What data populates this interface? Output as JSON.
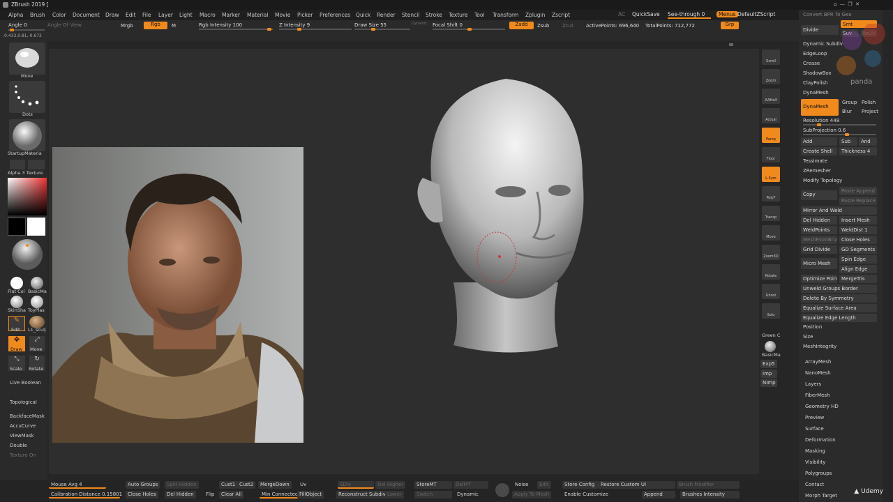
{
  "app": {
    "title": "ZBrush 2019 ["
  },
  "menus": [
    "Alpha",
    "Brush",
    "Color",
    "Document",
    "Draw",
    "Edit",
    "File",
    "Layer",
    "Light",
    "Macro",
    "Marker",
    "Material",
    "Movie",
    "Picker",
    "Preferences",
    "Quick",
    "Render",
    "Stencil",
    "Stroke",
    "Texture",
    "Tool",
    "Transform",
    "Zplugin",
    "Zscript"
  ],
  "menubar_right": {
    "ac": "AC",
    "quicksave": "QuickSave",
    "seethrough": "See-through  0",
    "menus": "Menus",
    "script": "DefaultZScript"
  },
  "ctrl": {
    "angle": "Angle 0",
    "angle_of_view": "Angle Of View",
    "mrgb": "Mrgb",
    "rgb": "Rgb",
    "m": "M",
    "rgb_intensity": "Rgb Intensity 100",
    "zadd": "Zadd",
    "zsub": "Zsub",
    "zcut": "Zcut",
    "z_intensity": "Z Intensity 9",
    "draw_size": "Draw Size 55",
    "dynamic": "Dynamic",
    "focal_shift": "Focal Shift 0",
    "active_points": "ActivePoints: 696,640",
    "total_points": "TotalPoints: 712,772",
    "grp": "Grp",
    "coords": "-0.433,0.81,-0.672"
  },
  "left": {
    "move": "Move",
    "dots": "Dots",
    "startup_material": "StartupMateria",
    "alpha_texture": "Alpha 3 Texture",
    "flat_col": "Flat Col",
    "basic_m": "BasicMa",
    "skin_shade": "SkinSha",
    "toy_plas": "ToyPlas",
    "edit": "Edit",
    "l1_scul": "L1_sculj",
    "draw": "Draw",
    "move2": "Move",
    "scale": "Scale",
    "rotate": "Rotate",
    "live_boolean": "Live Boolean",
    "topological": "Topological",
    "backface": "BackfaceMask",
    "accucurve": "AccuCurve",
    "viewmask": "ViewMask",
    "double": "Double",
    "texture_on": "Texture On"
  },
  "rtool": [
    "Scroll",
    "Zoom",
    "AAHalf",
    "Actual",
    "Persp",
    "Floor",
    "L.Sym",
    "PolyF",
    "Transp",
    "Move",
    "Zoom3D",
    "Rotate",
    "Ghost",
    "Solo"
  ],
  "rtool_bottom": {
    "green": "Green C",
    "basicmat": "BasicMa",
    "exp5": "Exp5",
    "imp": "Imp",
    "nimp": "NImp"
  },
  "rpal": {
    "convert": "Convert BPR To Geo",
    "divide": "Divide",
    "smt": "Smt",
    "suv": "Suv",
    "reuv": "ReUV",
    "dynamic_subdiv": "Dynamic Subdiv",
    "edgeloop": "EdgeLoop",
    "crease": "Crease",
    "shadowbox": "ShadowBox",
    "claypolish": "ClayPolish",
    "dynamesh_hdr": "DynaMesh",
    "dynamesh_btn": "DynaMesh",
    "group": "Group",
    "polish": "Polish",
    "blur": "Blur",
    "project": "Project",
    "resolution": "Resolution 448",
    "subprojection": "SubProjection 0.6",
    "add": "Add",
    "sub": "Sub",
    "and": "And",
    "create_shell": "Create Shell",
    "thickness": "Thickness 4",
    "tessimate": "Tessimate",
    "zremesher": "ZRemesher",
    "modify_topology": "Modify Topology",
    "copy": "Copy",
    "paste_append": "Paste Append",
    "paste_replace": "Paste Replace",
    "mirror_weld": "Mirror And Weld",
    "del_hidden": "Del Hidden",
    "insert_mesh": "Insert Mesh",
    "weldpoints": "WeldPoints",
    "welddist": "WeldDist 1",
    "meshfromb": "MeshFromBrush",
    "close_holes": "Close Holes",
    "grid_divide": "Grid Divide",
    "gd_segments": "GD Segments",
    "micro_mesh": "Micro Mesh",
    "spin_edge": "Spin Edge",
    "align_edge": "Align Edge",
    "optimize": "Optimize Points",
    "mergetris": "MergeTris",
    "unweld": "Unweld Groups Border",
    "delete_sym": "Delete By Symmetry",
    "equalize_area": "Equalize Surface Area",
    "equalize_edge": "Equalize Edge Length",
    "position": "Position",
    "size": "Size",
    "meshintegrity": "MeshIntegrity",
    "subpalettes": [
      "ArrayMesh",
      "NanoMesh",
      "Layers",
      "FiberMesh",
      "Geometry HD",
      "Preview",
      "Surface",
      "Deformation",
      "Masking",
      "Visibility",
      "Polygroups",
      "Contact",
      "Morph Target"
    ]
  },
  "bottom": {
    "mouse_avg": "Mouse Avg 4",
    "calibration": "Calibration Distance 0.15801",
    "auto_groups": "Auto Groups",
    "split_hidden": "Split Hidden",
    "close_holes": "Close Holes",
    "del_hidden": "Del Hidden",
    "cust1": "Cust1",
    "cust2": "Cust2",
    "mergedown": "MergeDown",
    "uv": "Uv",
    "flip": "Flip",
    "clear_all": "Clear All",
    "min_connected": "Min Connected",
    "fillobject": "FillObject",
    "sdiv": "SDiv",
    "del_higher": "Del Higher",
    "storemt": "StoreMT",
    "delmt": "DelMT",
    "reconstruct": "Reconstruct Subdiv",
    "lower": "Lower",
    "switch": "Switch",
    "dynamic": "Dynamic",
    "noise": "Noise",
    "edit": "Edit",
    "apply_mesh": "Apply To Mesh",
    "store_config": "Store Config",
    "restore_ui": "Restore Custom UI",
    "brush_modifier": "Brush Modifier",
    "enable_customize": "Enable Customize",
    "append": "Append",
    "brushes_intensity": "Brushes Intensity"
  },
  "watermark": {
    "udemy": "Udemy",
    "panda": "panda"
  },
  "colors": {
    "accent": "#f08a1c",
    "bg": "#262626"
  }
}
